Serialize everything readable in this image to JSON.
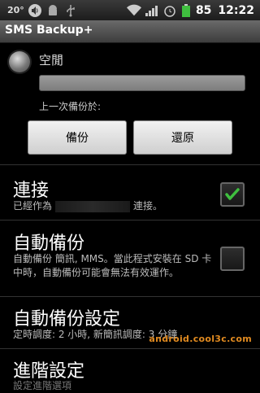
{
  "statusbar": {
    "temperature": "20°",
    "battery_percent": "85",
    "time": "12:22"
  },
  "app": {
    "title": "SMS Backup+"
  },
  "status": {
    "state_label": "空閒",
    "last_backup_label": "上一次備份於:"
  },
  "buttons": {
    "backup": "備份",
    "restore": "還原"
  },
  "prefs": {
    "connect": {
      "title": "連接",
      "summary_prefix": "已經作為",
      "summary_suffix": "連接。",
      "checked": true
    },
    "auto_backup": {
      "title": "自動備份",
      "summary": "自動備份 簡訊, MMS。當此程式安裝在 SD 卡中時，自動備份可能會無法有效運作。",
      "checked": false
    },
    "auto_backup_settings": {
      "title": "自動備份設定",
      "summary": "定時調度: 2 小時, 新簡訊調度: 3 分鐘"
    },
    "advanced": {
      "title": "進階設定",
      "summary": "設定進階選項"
    }
  },
  "watermark": "android.cool3c.com",
  "colors": {
    "check_green": "#3fbf3f",
    "watermark": "#e08a20"
  }
}
